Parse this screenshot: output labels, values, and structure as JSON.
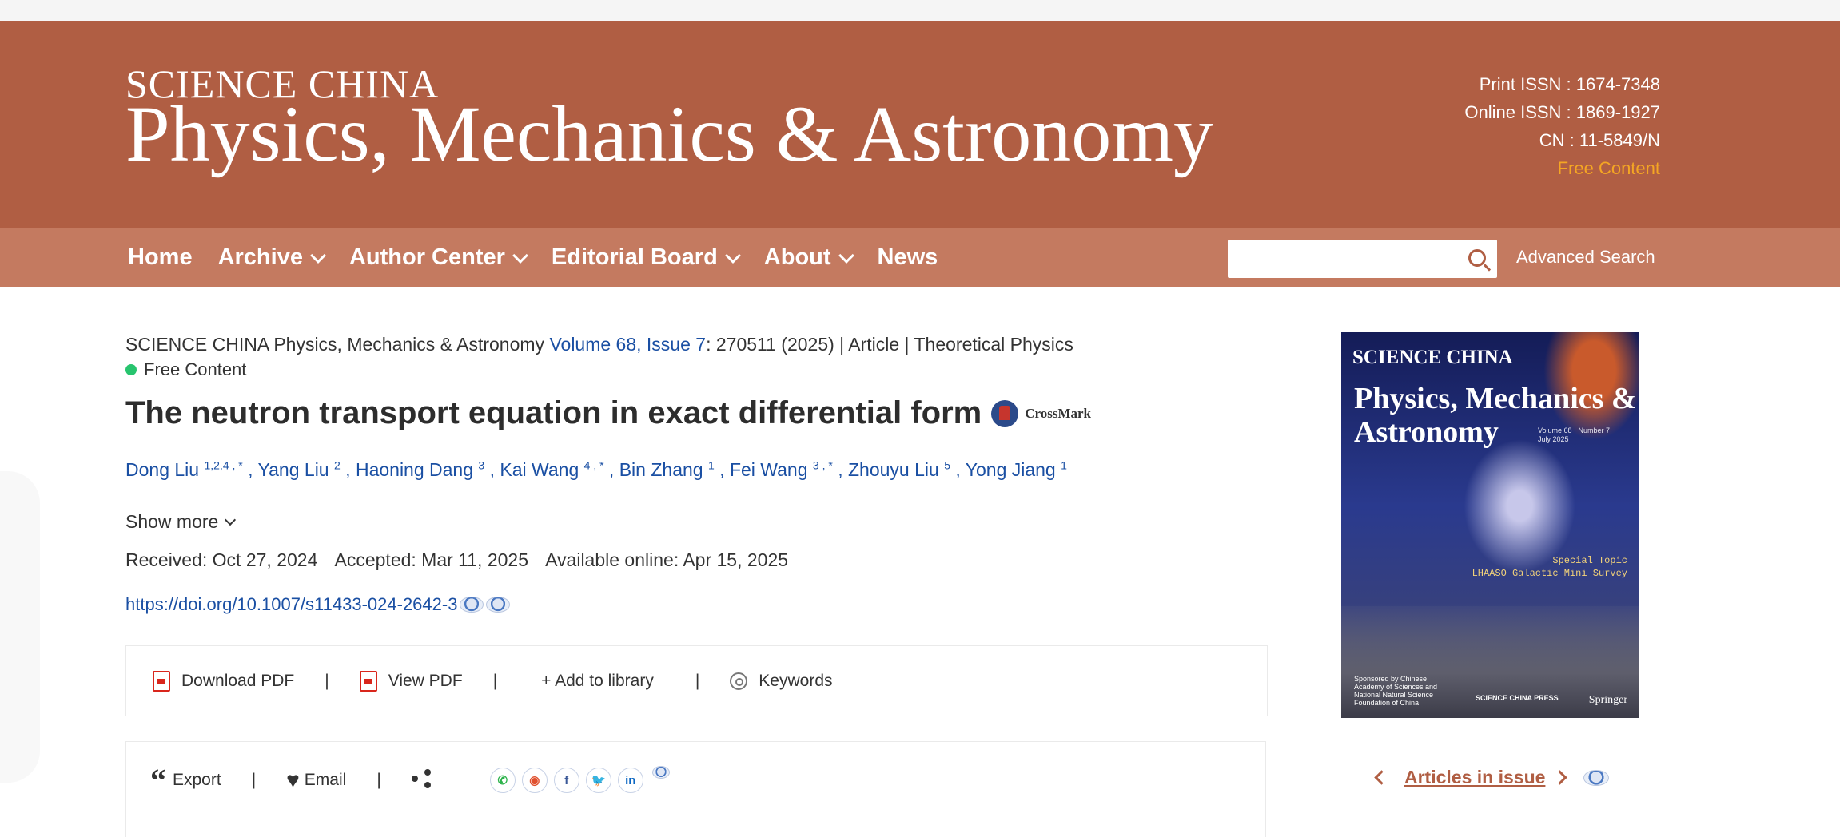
{
  "header": {
    "logo_top": "SCIENCE CHINA",
    "logo_main": "Physics, Mechanics & Astronomy",
    "print_issn": "Print ISSN : 1674-7348",
    "online_issn": "Online ISSN : 1869-1927",
    "cn": "CN : 11-5849/N",
    "free_content": "Free Content"
  },
  "nav": {
    "items": [
      {
        "label": "Home"
      },
      {
        "label": "Archive"
      },
      {
        "label": "Author Center"
      },
      {
        "label": "Editorial Board"
      },
      {
        "label": "About"
      },
      {
        "label": "News"
      }
    ],
    "search_placeholder": "",
    "advanced_search": "Advanced Search"
  },
  "article": {
    "journal": "SCIENCE CHINA Physics, Mechanics & Astronomy",
    "volume_issue": "Volume 68, Issue 7",
    "citation_rest": ": 270511 (2025) | Article | Theoretical Physics",
    "free_content": "Free Content",
    "title": "The neutron transport equation in exact differential form",
    "crossmark": "CrossMark",
    "authors": [
      {
        "name": "Dong Liu",
        "sup": "1,2,4 , *"
      },
      {
        "name": "Yang Liu",
        "sup": "2"
      },
      {
        "name": "Haoning Dang",
        "sup": "3"
      },
      {
        "name": "Kai Wang",
        "sup": "4 , *"
      },
      {
        "name": "Bin Zhang",
        "sup": "1"
      },
      {
        "name": "Fei Wang",
        "sup": "3 , *"
      },
      {
        "name": "Zhouyu Liu",
        "sup": "5"
      },
      {
        "name": "Yong Jiang",
        "sup": "1"
      }
    ],
    "show_more": "Show more",
    "received": "Received: Oct 27, 2024",
    "accepted": "Accepted: Mar 11, 2025",
    "available": "Available online: Apr 15, 2025",
    "doi": "https://doi.org/10.1007/s11433-024-2642-3"
  },
  "toolbar": {
    "download_pdf": "Download PDF",
    "view_pdf": "View PDF",
    "add_library": "+ Add to library",
    "keywords": "Keywords",
    "separator": "|"
  },
  "toolbar2": {
    "export": "Export",
    "email": "Email",
    "separator": "|",
    "social_icons": [
      "wechat-icon",
      "weibo-icon",
      "facebook-icon",
      "twitter-icon",
      "linkedin-icon"
    ],
    "social_labels": [
      "✆",
      "◉",
      "f",
      "🐦",
      "in"
    ]
  },
  "cover": {
    "brand": "SCIENCE CHINA",
    "title": "Physics, Mechanics & Astronomy",
    "volume": "Volume 68 · Number 7",
    "date": "July 2025",
    "special_topic": "Special Topic",
    "topic_name": "LHAASO Galactic Mini Survey",
    "press": "SCIENCE CHINA PRESS",
    "publisher": "Springer",
    "sponsor": "Sponsored by Chinese Academy of Sciences and National Natural Science Foundation of China"
  },
  "sidebar": {
    "articles_in_issue": "Articles in issue"
  },
  "colors": {
    "banner": "#b05e43",
    "navbar": "#c47a60",
    "link": "#1a4fa3",
    "free_accent": "#f5a623",
    "free_dot": "#27c46e"
  }
}
